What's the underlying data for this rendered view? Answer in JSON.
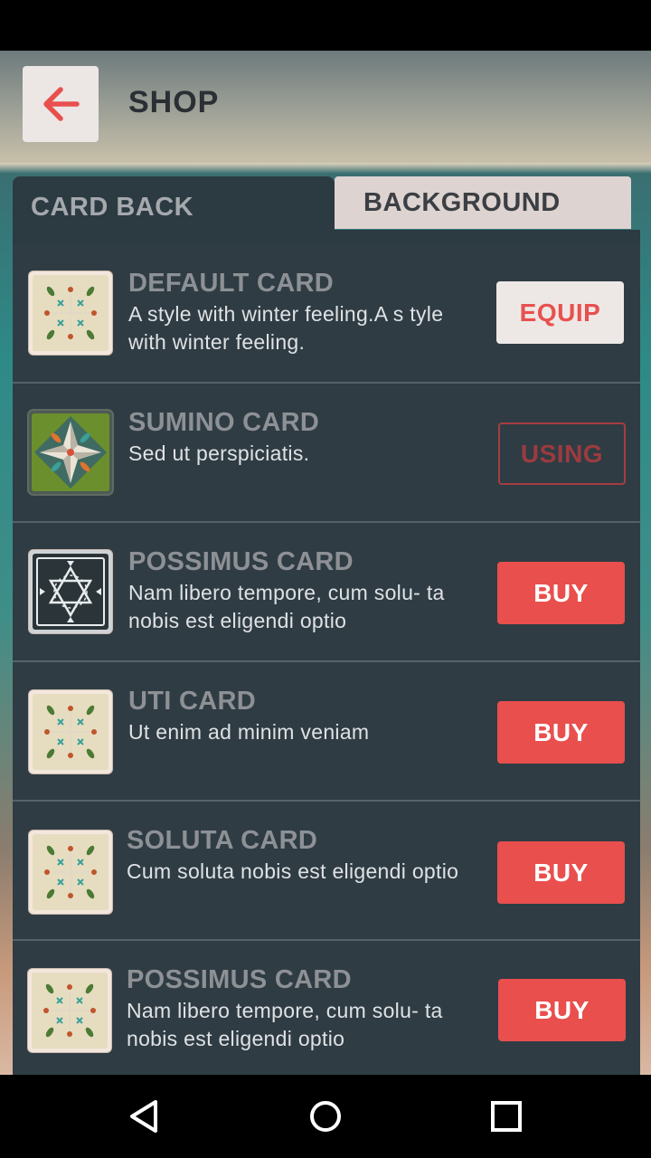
{
  "header": {
    "title": "SHOP"
  },
  "tabs": [
    {
      "label": "CARD BACK"
    },
    {
      "label": "BACKGROUND"
    }
  ],
  "items": [
    {
      "name": "DEFAULT CARD",
      "desc": "A style with winter feeling.A s tyle with winter feeling.",
      "action": "EQUIP",
      "thumb": "winter-pattern"
    },
    {
      "name": "SUMINO CARD",
      "desc": "Sed ut perspiciatis.",
      "action": "USING",
      "thumb": "star-green-pattern"
    },
    {
      "name": "POSSIMUS CARD",
      "desc": "Nam libero tempore, cum solu- ta nobis est eligendi optio",
      "action": "BUY",
      "thumb": "hexagram-dark-pattern"
    },
    {
      "name": "UTI CARD",
      "desc": "Ut enim ad minim veniam",
      "action": "BUY",
      "thumb": "winter-pattern"
    },
    {
      "name": "SOLUTA CARD",
      "desc": "Cum soluta nobis est eligendi optio",
      "action": "BUY",
      "thumb": "winter-pattern"
    },
    {
      "name": "POSSIMUS CARD",
      "desc": "Nam libero tempore, cum solu- ta nobis est eligendi optio",
      "action": "BUY",
      "thumb": "winter-pattern"
    }
  ],
  "colors": {
    "accent": "#e94f4d",
    "panel": "#2c3a42",
    "tab_active": "#ddd3d0"
  },
  "icons": {
    "back": "arrow-left-icon",
    "nav_back": "triangle-back-icon",
    "nav_home": "circle-home-icon",
    "nav_recents": "square-recents-icon"
  }
}
